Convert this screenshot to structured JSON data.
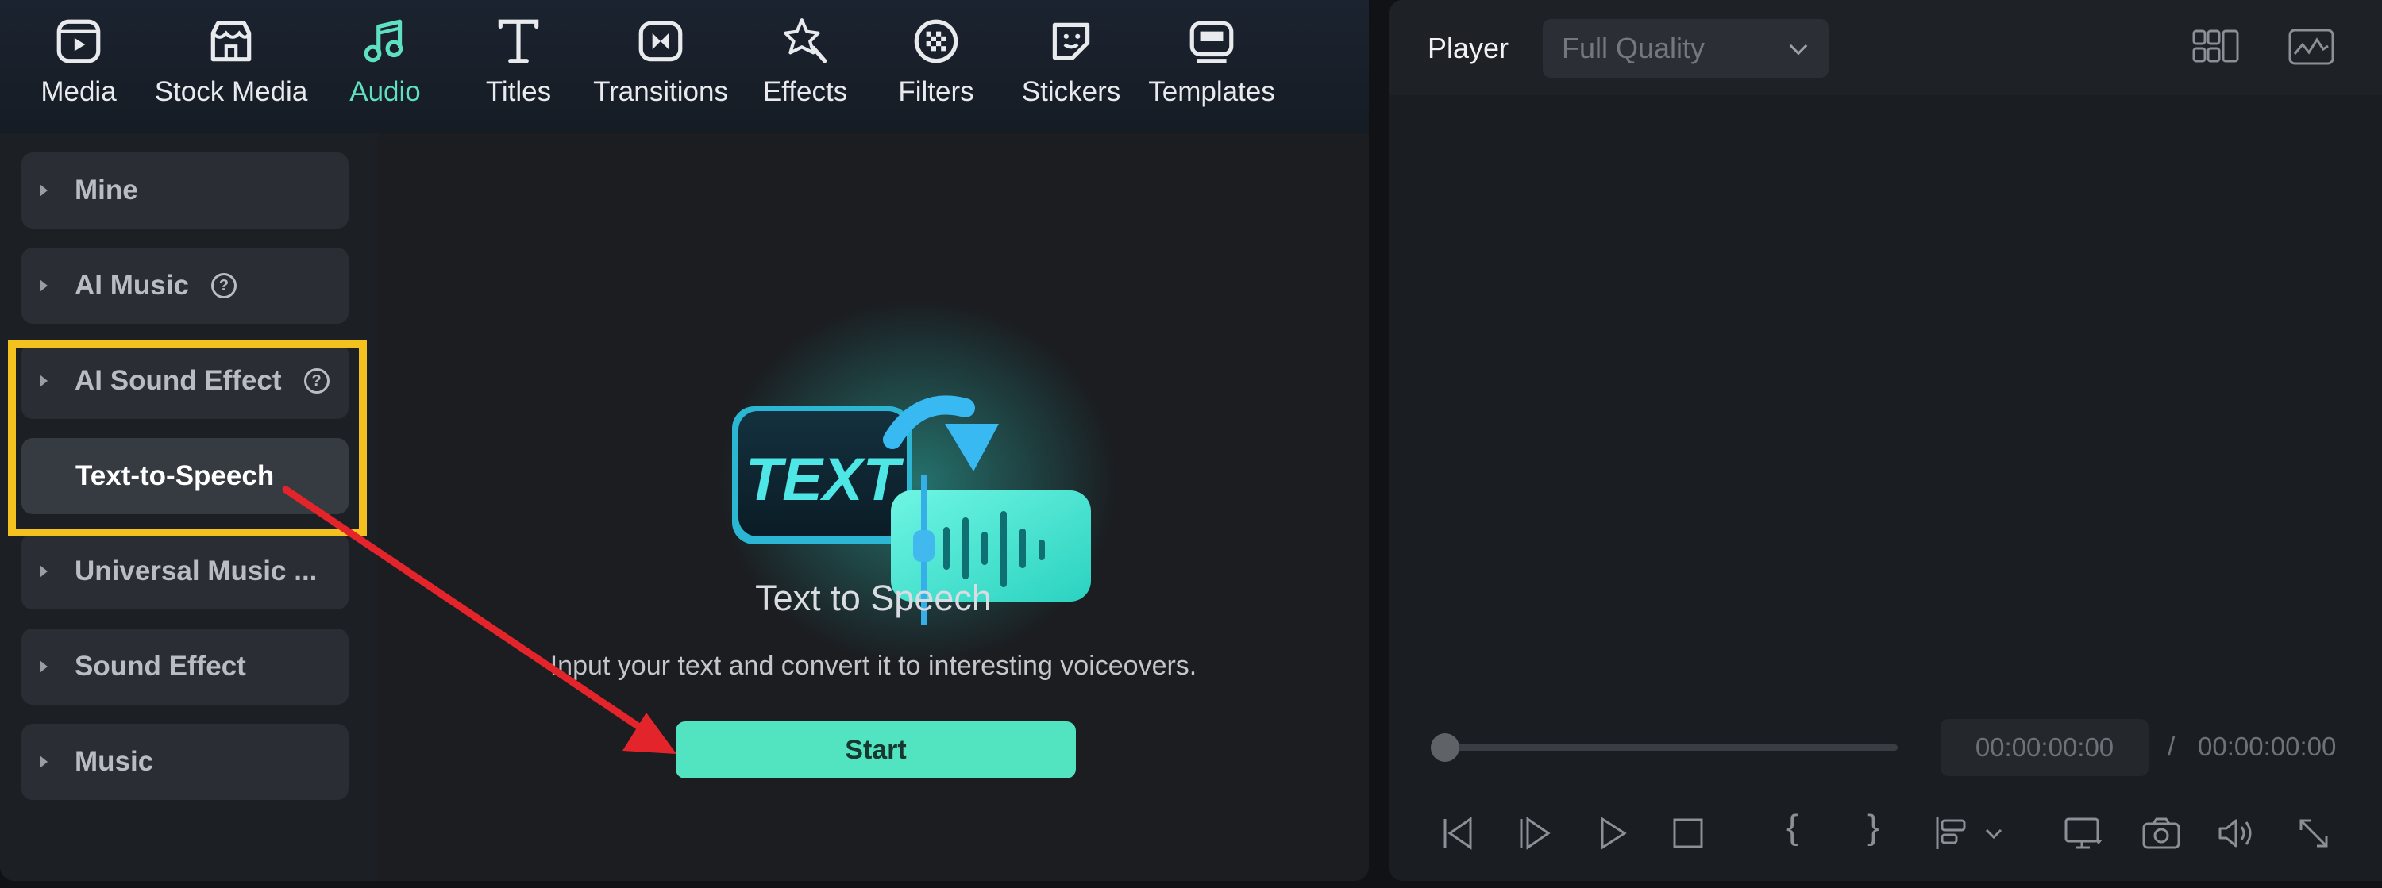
{
  "toolbar": {
    "items": [
      {
        "label": "Media",
        "icon": "media-icon"
      },
      {
        "label": "Stock Media",
        "icon": "stock-media-icon"
      },
      {
        "label": "Audio",
        "icon": "audio-note-icon",
        "active": true
      },
      {
        "label": "Titles",
        "icon": "titles-icon"
      },
      {
        "label": "Transitions",
        "icon": "transitions-icon"
      },
      {
        "label": "Effects",
        "icon": "effects-icon"
      },
      {
        "label": "Filters",
        "icon": "filters-icon"
      },
      {
        "label": "Stickers",
        "icon": "stickers-icon"
      },
      {
        "label": "Templates",
        "icon": "templates-icon"
      }
    ]
  },
  "sidebar": {
    "items": [
      {
        "label": "Mine"
      },
      {
        "label": "AI Music",
        "help": "?"
      },
      {
        "label": "AI Sound Effect",
        "help": "?"
      },
      {
        "label": "Text-to-Speech",
        "selected": true
      },
      {
        "label": "Universal Music ..."
      },
      {
        "label": "Sound Effect"
      },
      {
        "label": "Music"
      }
    ]
  },
  "content": {
    "illustration_text": "TEXT",
    "title": "Text to Speech",
    "description": "Input your text and convert it to interesting voiceovers.",
    "start_label": "Start"
  },
  "player": {
    "label": "Player",
    "quality": "Full Quality",
    "current_time": "00:00:00:00",
    "separator": "/",
    "total_time": "00:00:00:00",
    "progress": 0,
    "mark_in": "{",
    "mark_out": "}"
  },
  "colors": {
    "accent": "#52e3c0",
    "highlight": "#f4c21e",
    "annotation_arrow": "#e3252b"
  }
}
